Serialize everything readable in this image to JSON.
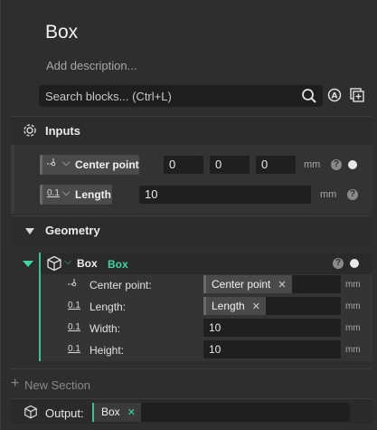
{
  "header": {
    "title": "Box",
    "description_placeholder": "Add description..."
  },
  "search": {
    "placeholder": "Search blocks... (Ctrl+L)",
    "icons": [
      "search-icon",
      "auto-arrange-icon",
      "add-block-icon"
    ]
  },
  "inputs": {
    "label": "Inputs",
    "params": [
      {
        "type_icon": "point-icon",
        "name": "Center point",
        "values": [
          "0",
          "0",
          "0"
        ],
        "unit": "mm",
        "help": "?"
      },
      {
        "type_icon": "0.1",
        "name": "Length",
        "value": "10",
        "unit": "mm",
        "help": "?"
      }
    ]
  },
  "geometry": {
    "label": "Geometry",
    "block": {
      "name": "Box",
      "subtitle": "Box",
      "help": "?",
      "params": [
        {
          "type_icon": "point-icon",
          "label": "Center point:",
          "chip": "Center point",
          "unit": "mm"
        },
        {
          "type_icon": "0.1",
          "label": "Length:",
          "chip": "Length",
          "unit": "mm"
        },
        {
          "type_icon": "0.1",
          "label": "Width:",
          "value": "10",
          "unit": "mm"
        },
        {
          "type_icon": "0.1",
          "label": "Height:",
          "value": "10",
          "unit": "mm"
        }
      ]
    }
  },
  "footer": {
    "new_section": "New Section",
    "output_label": "Output:",
    "output_chip": "Box"
  },
  "colors": {
    "accent": "#3fd6a0",
    "background": "#2e2e2e",
    "field": "#1f1f1f"
  }
}
